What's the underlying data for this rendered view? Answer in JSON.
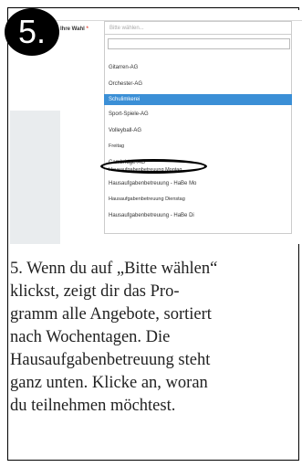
{
  "step": {
    "number": "5."
  },
  "form": {
    "label": "Ihre Wahl",
    "required_mark": "*",
    "select_placeholder": "Bitte wählen..."
  },
  "dropdown": {
    "options": [
      "Gitarren-AG",
      "Orchester-AG",
      "Schulimkerei",
      "Sport-Spiele-AG",
      "Volleyball-AG",
      "Freitag",
      "Cambridge-AG",
      "Hausaufgabenbetreuung Montag",
      "Hausaufgabenbetreuung - HaBe Mo",
      "Hausaufgabenbetreuung Dienstag",
      "Hausaufgabenbetreuung - HaBe Di"
    ],
    "highlighted": "Schulimkerei",
    "circled": "Hausaufgabenbetreuung Montag"
  },
  "instructions": {
    "lines": [
      "5. Wenn du auf „Bitte wählen“",
      "klickst, zeigt dir das Pro-",
      "gramm alle Angebote, sortiert",
      "nach Wochentagen. Die",
      "Hausaufgabenbetreuung steht",
      "ganz unten. Klicke an, woran",
      "du teilnehmen möchtest."
    ]
  }
}
